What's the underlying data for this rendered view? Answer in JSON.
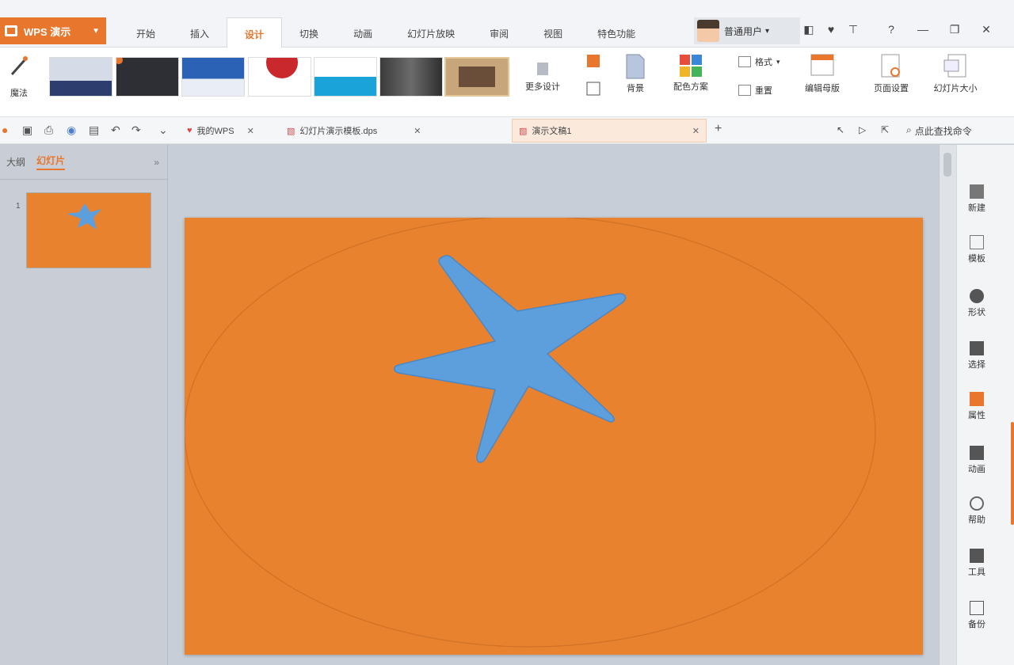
{
  "app": {
    "name": "WPS 演示"
  },
  "menu_tabs": [
    "开始",
    "插入",
    "设计",
    "切换",
    "动画",
    "幻灯片放映",
    "审阅",
    "视图",
    "特色功能"
  ],
  "menu_active": 2,
  "user": {
    "name": "普通用户"
  },
  "ribbon": {
    "magic_label": "魔法",
    "more_designs_label": "更多设计",
    "background_label": "背景",
    "color_scheme_label": "配色方案",
    "format_label": "格式",
    "reset_label": "重置",
    "edit_master_label": "编辑母版",
    "page_setup_label": "页面设置",
    "slide_size_label": "幻灯片大小"
  },
  "doc_tabs": [
    {
      "label": "我的WPS",
      "active": false
    },
    {
      "label": "幻灯片演示模板.dps",
      "active": false
    },
    {
      "label": "演示文稿1",
      "active": true
    }
  ],
  "find_label": "点此查找命令",
  "left_panel": {
    "tab_outline": "大纲",
    "tab_slides": "幻灯片",
    "slide_number": "1"
  },
  "right_pane": [
    {
      "icon": "new-icon",
      "label": "新建"
    },
    {
      "icon": "template-icon",
      "label": "模板"
    },
    {
      "icon": "shape-icon",
      "label": "形状"
    },
    {
      "icon": "select-icon",
      "label": "选择"
    },
    {
      "icon": "property-icon",
      "label": "属性"
    },
    {
      "icon": "animation-icon",
      "label": "动画"
    },
    {
      "icon": "tips-icon",
      "label": "帮助"
    },
    {
      "icon": "tools-icon",
      "label": "工具"
    },
    {
      "icon": "backup-icon",
      "label": "备份"
    }
  ],
  "colors": {
    "accent": "#e8762c",
    "slide_bg": "#e8822f",
    "star": "#5d9fdc",
    "workspace": "#c8ced7"
  }
}
